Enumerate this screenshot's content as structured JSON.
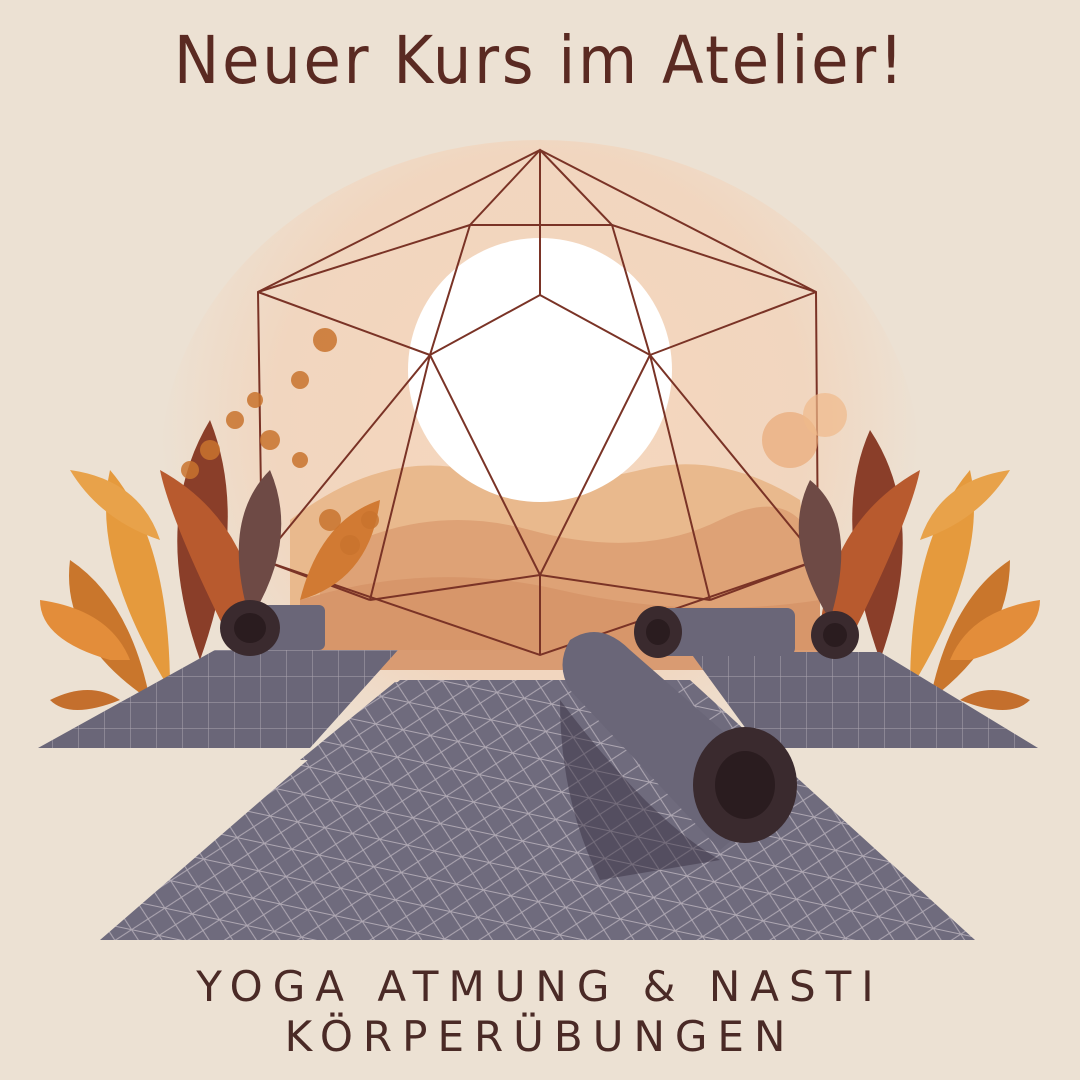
{
  "headline": "Neuer Kurs im Atelier!",
  "tagline_line1": "YOGA ATMUNG & NASTI",
  "tagline_line2": "KÖRPERÜBUNGEN",
  "colors": {
    "background": "#ece1d3",
    "text": "#5a2a22",
    "mat": "#6f6b7d",
    "leaf_orange": "#d9822f",
    "leaf_brown": "#7a3a28",
    "sun": "#ffffff"
  },
  "icons": [
    "geodesic-dome-icon",
    "sun-icon",
    "leaf-icon",
    "rolled-yoga-mat-icon"
  ]
}
